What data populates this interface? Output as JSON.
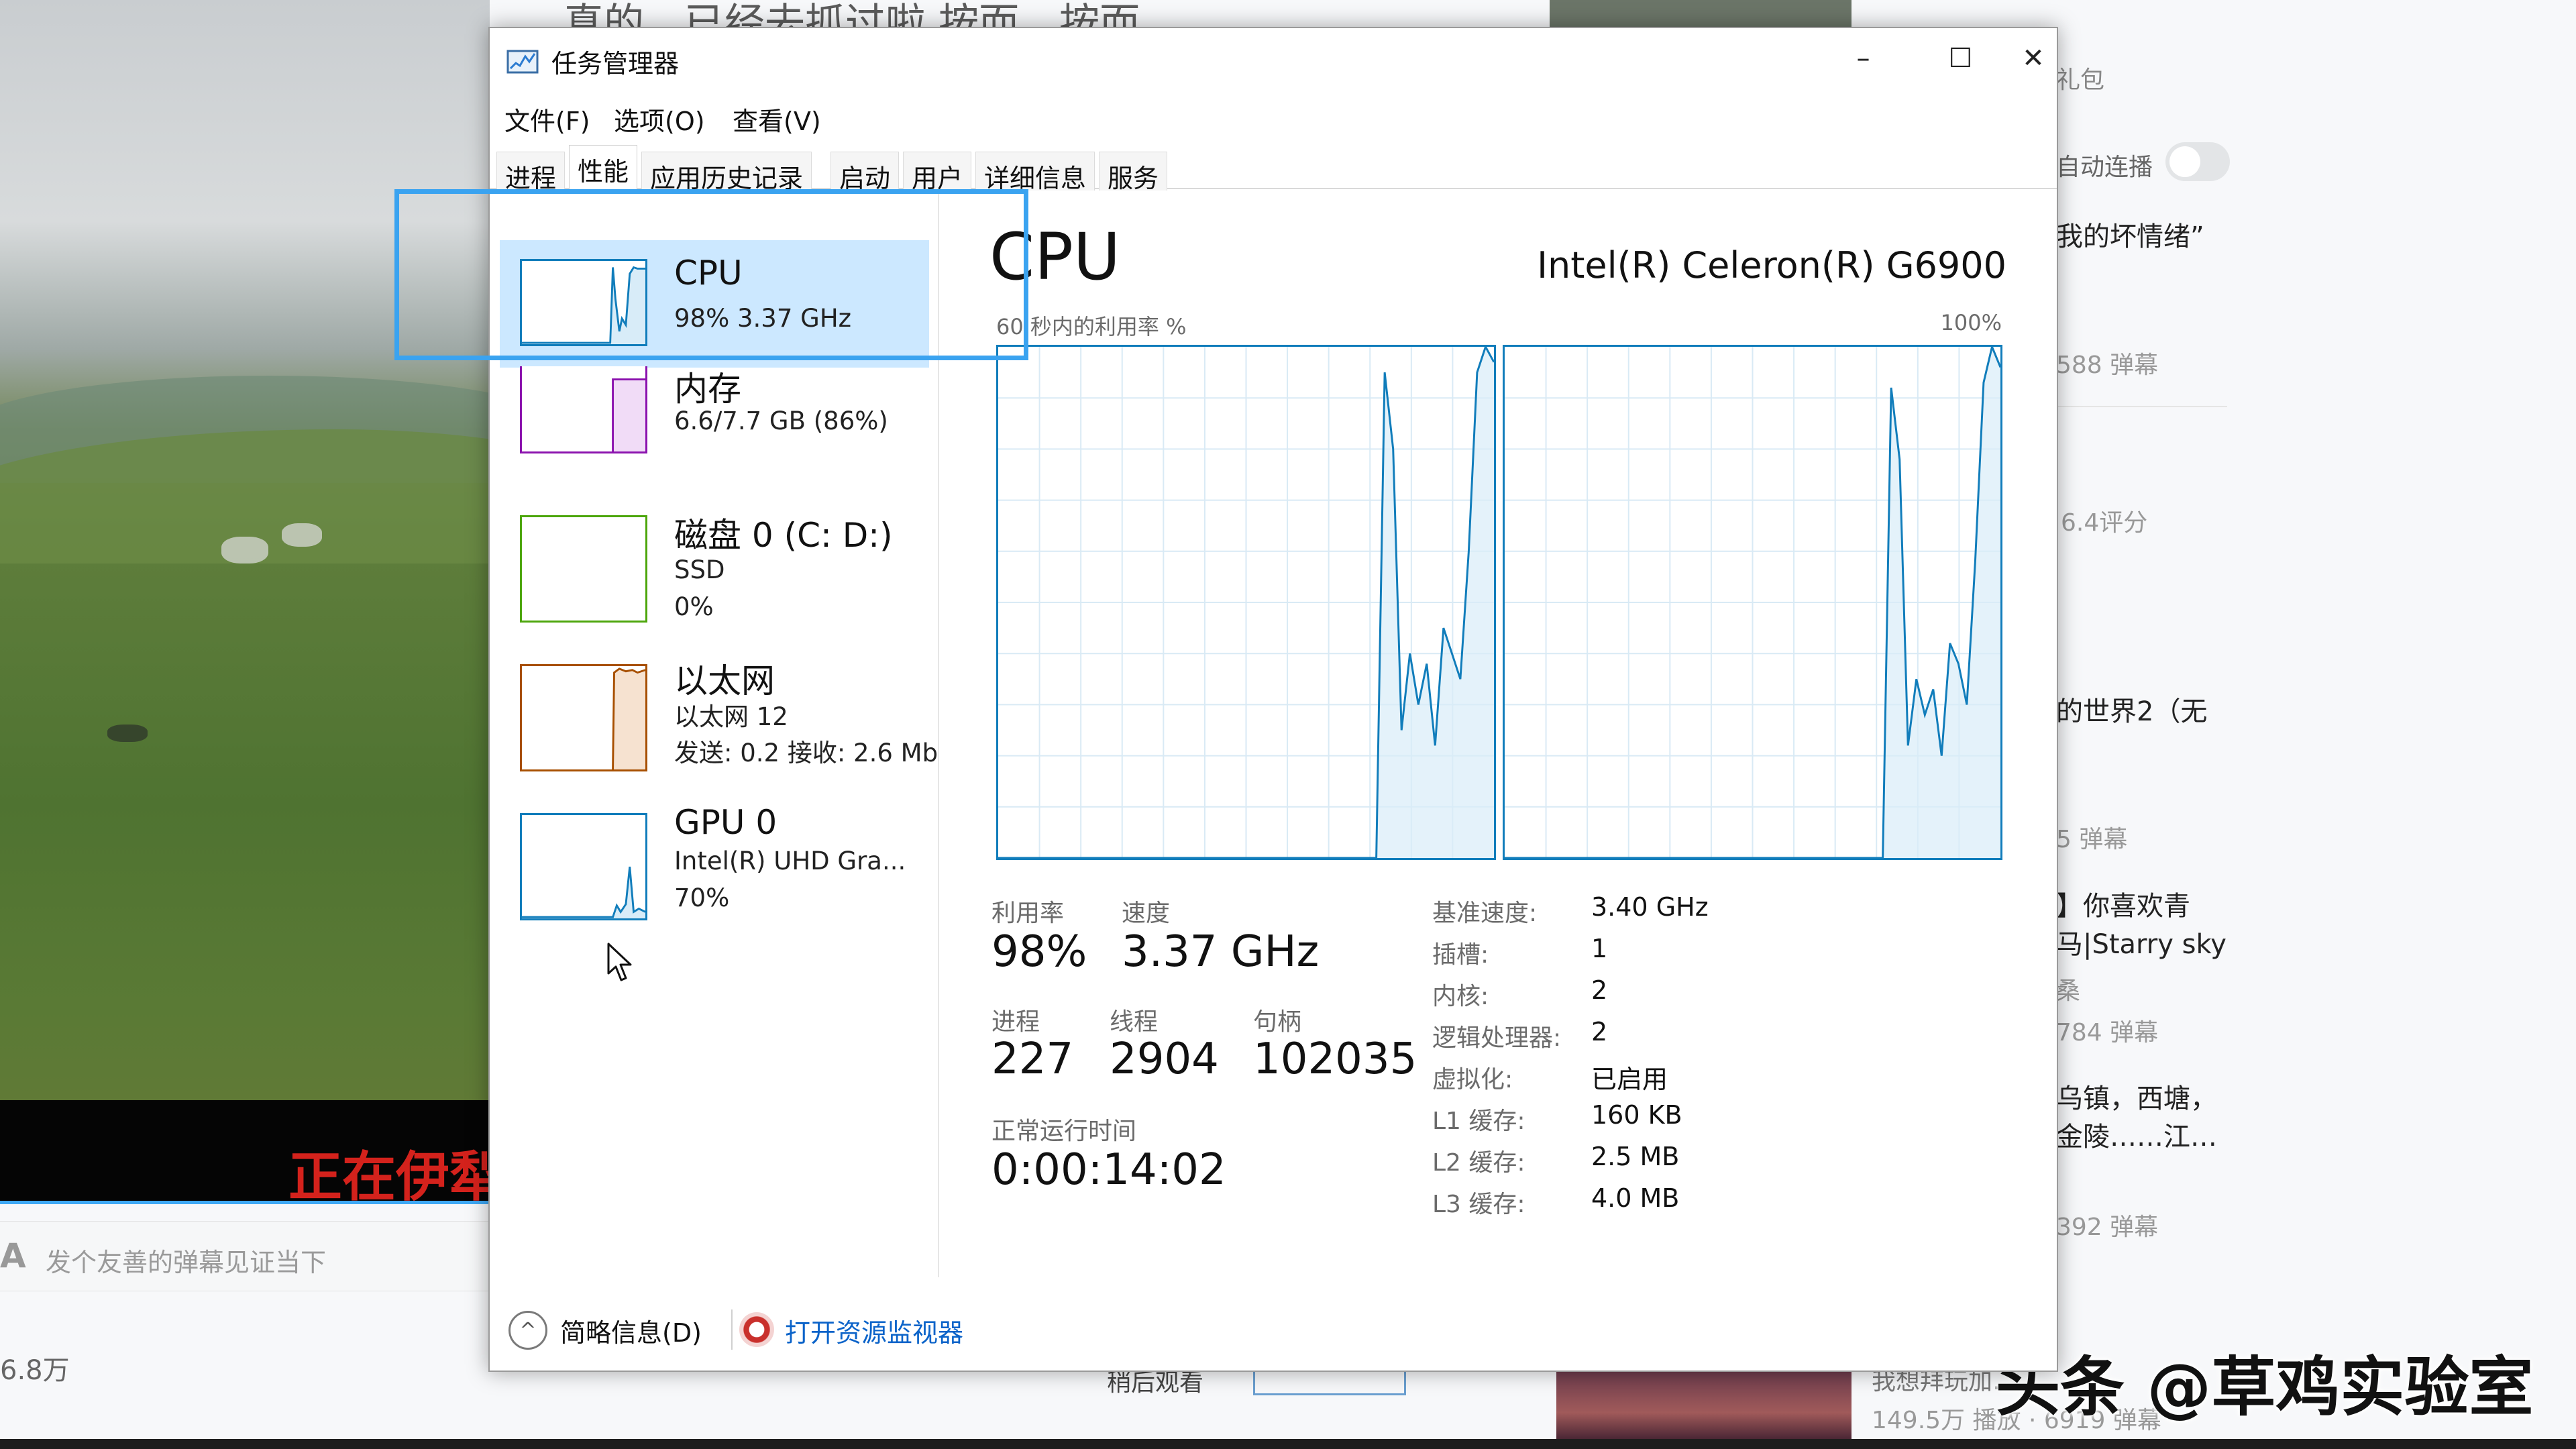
{
  "background_page": {
    "top_strip_text": "真的，已经去抓过啦      按而，按而，",
    "video_subtitle": "正在伊犁",
    "danmaku_placeholder": "发个友善的弹幕见证当下",
    "danmaku_icon": "A",
    "view_count": "6.8万",
    "bottom_partial_label": "稍后观看"
  },
  "sidebar": {
    "gift": "礼包",
    "autoplay_label": "自动连播",
    "item1_title": "我的坏情绪”",
    "item1_meta": "588 弹幕",
    "item2_meta": "6.4评分",
    "item3_title": "的世界2（无",
    "item3_meta": "5 弹幕",
    "item4_title_line1": "】你喜欢青",
    "item4_title_line2": "马|Starry sky",
    "item4_meta_a": "桑",
    "item4_meta": "784 弹幕",
    "item5_title_line1": "乌镇，西塘，",
    "item5_title_line2": "金陵……江…",
    "item5_meta": "392 弹幕",
    "item6_title": "我想拜玩加…",
    "item6_meta": "149.5万 播放 · 6919 弹幕"
  },
  "watermark": "头条 @草鸡实验室",
  "task_manager": {
    "title": "任务管理器",
    "window_controls": {
      "minimize": "–",
      "maximize": "☐",
      "close": "✕"
    },
    "menu": [
      "文件(F)",
      "选项(O)",
      "查看(V)"
    ],
    "tabs": [
      "进程",
      "性能",
      "应用历史记录",
      "启动",
      "用户",
      "详细信息",
      "服务"
    ],
    "active_tab": "性能",
    "side_items": [
      {
        "name": "CPU",
        "line1": "98%  3.37 GHz",
        "line2": "",
        "color": "#117dbb"
      },
      {
        "name": "内存",
        "line1": "6.6/7.7 GB (86%)",
        "line2": "",
        "color": "#8b12ae"
      },
      {
        "name": "磁盘 0 (C: D:)",
        "line1": "SSD",
        "line2": "0%",
        "color": "#4da60c"
      },
      {
        "name": "以太网",
        "line1": "以太网 12",
        "line2": "发送: 0.2  接收: 2.6 Mb",
        "color": "#a74f01"
      },
      {
        "name": "GPU 0",
        "line1": "Intel(R) UHD Gra...",
        "line2": "70%",
        "color": "#117dbb"
      }
    ],
    "main": {
      "title": "CPU",
      "model": "Intel(R) Celeron(R) G6900",
      "graph_caption": "60 秒内的利用率 %",
      "graph_max": "100%",
      "stats": {
        "utilization_label": "利用率",
        "utilization": "98%",
        "speed_label": "速度",
        "speed": "3.37 GHz",
        "processes_label": "进程",
        "processes": "227",
        "threads_label": "线程",
        "threads": "2904",
        "handles_label": "句柄",
        "handles": "102035",
        "uptime_label": "正常运行时间",
        "uptime": "0:00:14:02"
      },
      "specs": [
        {
          "key": "基准速度:",
          "value": "3.40 GHz"
        },
        {
          "key": "插槽:",
          "value": "1"
        },
        {
          "key": "内核:",
          "value": "2"
        },
        {
          "key": "逻辑处理器:",
          "value": "2"
        },
        {
          "key": "虚拟化:",
          "value": "已启用"
        },
        {
          "key": "L1 缓存:",
          "value": "160 KB"
        },
        {
          "key": "L2 缓存:",
          "value": "2.5 MB"
        },
        {
          "key": "L3 缓存:",
          "value": "4.0 MB"
        }
      ]
    },
    "footer": {
      "fewer_details": "简略信息(D)",
      "fewer_details_icon": "^",
      "open_resmon": "打开资源监视器"
    },
    "core_graphs": [
      {
        "utilization_pct": [
          0,
          0,
          0,
          0,
          0,
          0,
          0,
          0,
          0,
          0,
          0,
          0,
          0,
          0,
          0,
          0,
          0,
          0,
          0,
          0,
          0,
          0,
          0,
          0,
          0,
          0,
          0,
          0,
          0,
          0,
          0,
          0,
          0,
          0,
          0,
          0,
          0,
          0,
          0,
          0,
          0,
          0,
          0,
          0,
          0,
          0,
          95,
          80,
          25,
          40,
          30,
          38,
          22,
          45,
          40,
          35,
          60,
          95,
          100,
          97
        ]
      },
      {
        "utilization_pct": [
          0,
          0,
          0,
          0,
          0,
          0,
          0,
          0,
          0,
          0,
          0,
          0,
          0,
          0,
          0,
          0,
          0,
          0,
          0,
          0,
          0,
          0,
          0,
          0,
          0,
          0,
          0,
          0,
          0,
          0,
          0,
          0,
          0,
          0,
          0,
          0,
          0,
          0,
          0,
          0,
          0,
          0,
          0,
          0,
          0,
          0,
          92,
          78,
          22,
          35,
          28,
          33,
          20,
          42,
          38,
          30,
          58,
          93,
          100,
          96
        ]
      }
    ]
  }
}
